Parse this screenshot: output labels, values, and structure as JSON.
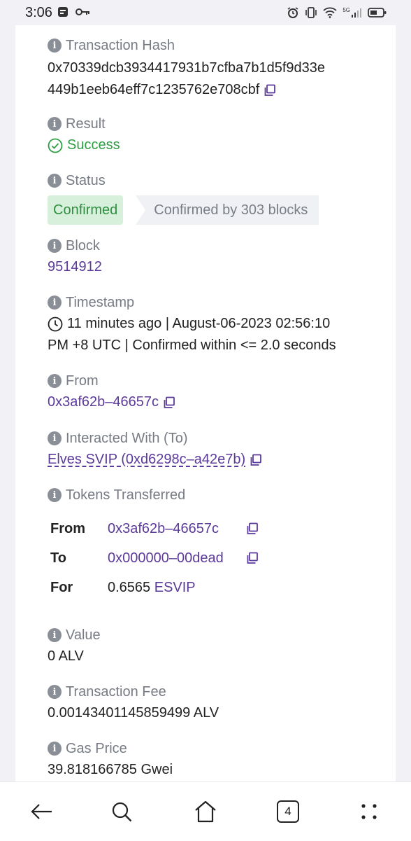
{
  "status_bar": {
    "time": "3:06",
    "signal_label": "5G"
  },
  "tx": {
    "hash_label": "Transaction Hash",
    "hash_line1": "0x70339dcb3934417931b7cfba7b1d5f9d33e",
    "hash_line2": "449b1eeb64eff7c1235762e708cbf",
    "result_label": "Result",
    "result_value": "Success",
    "status_label": "Status",
    "status_badge": "Confirmed",
    "status_blocks": "Confirmed by 303 blocks",
    "block_label": "Block",
    "block_value": "9514912",
    "timestamp_label": "Timestamp",
    "timestamp_line1": "11 minutes ago | August-06-2023 02:56:10",
    "timestamp_line2": "PM +8 UTC | Confirmed within <= 2.0 seconds",
    "from_label": "From",
    "from_value": "0x3af62b–46657c",
    "to_label": "Interacted With (To)",
    "to_value": "Elves SVIP (0xd6298c–a42e7b)",
    "tokens_label": "Tokens Transferred",
    "tokens": {
      "from_key": "From",
      "from_value": "0x3af62b–46657c",
      "to_key": "To",
      "to_value": "0x000000–00dead",
      "for_key": "For",
      "for_amount": "0.6565",
      "for_token": "ESVIP"
    },
    "value_label": "Value",
    "value_value": "0 ALV",
    "fee_label": "Transaction Fee",
    "fee_value": "0.00143401145859499 ALV",
    "gas_label": "Gas Price",
    "gas_value": "39.818166785 Gwei"
  },
  "nav": {
    "tab_count": "4"
  },
  "colors": {
    "link": "#5b3a9a",
    "success": "#2e9e44",
    "label": "#777b84"
  }
}
